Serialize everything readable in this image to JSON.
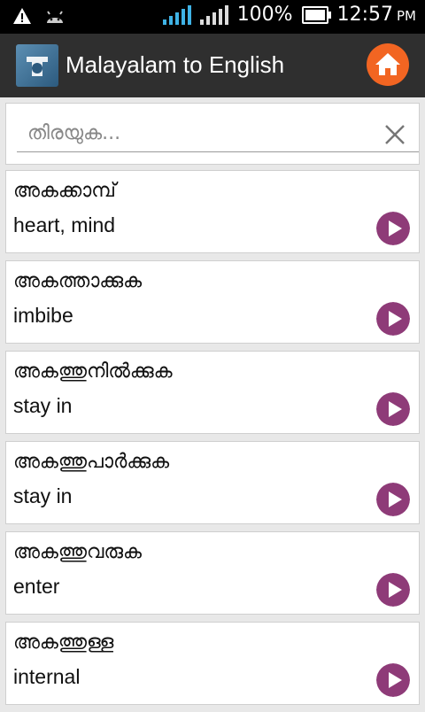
{
  "status_bar": {
    "battery": "100%",
    "time": "12:57",
    "ampm": "PM"
  },
  "app_bar": {
    "title": "Malayalam to English",
    "accent_color": "#f26522"
  },
  "search": {
    "placeholder": "തിരയുക..."
  },
  "entries": [
    {
      "ml": "അകക്കാമ്പ്",
      "en": "heart, mind"
    },
    {
      "ml": "അകത്താക്കുക",
      "en": "imbibe"
    },
    {
      "ml": "അകത്തുനിൽക്കുക",
      "en": "stay in"
    },
    {
      "ml": "അകത്തുപാർക്കുക",
      "en": "stay in"
    },
    {
      "ml": "അകത്തുവരുക",
      "en": "enter"
    },
    {
      "ml": "അകത്തുള്ള",
      "en": "internal"
    }
  ],
  "colors": {
    "play_button": "#8e3b78",
    "signal": "#3fb3e6"
  },
  "icons": {
    "home": "home-icon",
    "play": "play-icon",
    "clear": "close-icon"
  }
}
